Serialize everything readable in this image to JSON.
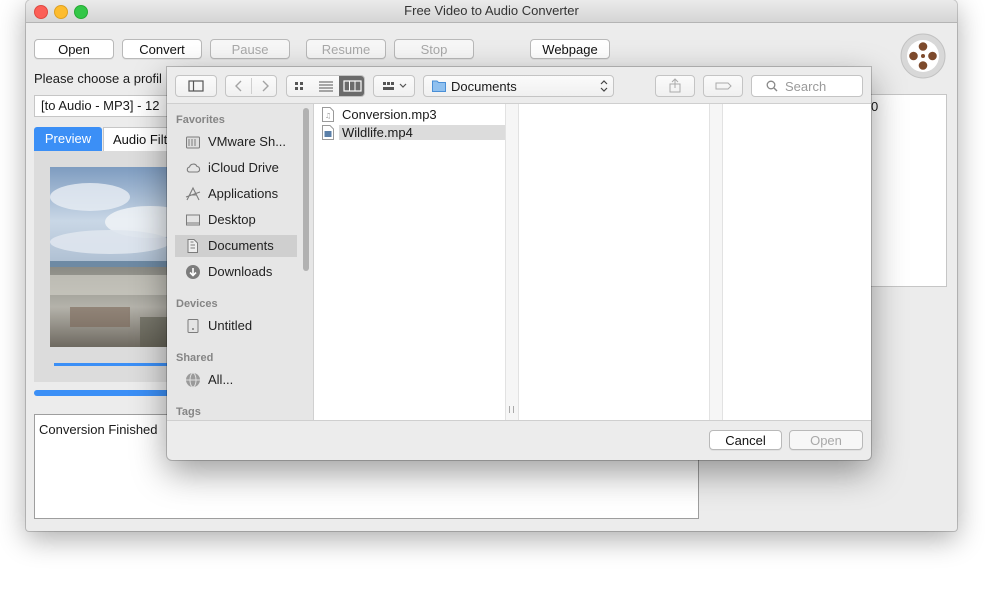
{
  "window": {
    "title": "Free Video to Audio Converter",
    "buttons": {
      "open": "Open",
      "convert": "Convert",
      "pause": "Pause",
      "resume": "Resume",
      "stop": "Stop",
      "webpage": "Webpage"
    },
    "profile_label": "Please choose a profil",
    "profile_value": "[to Audio - MP3] - 12",
    "tabs": {
      "preview": "Preview",
      "audio_filter": "Audio Filt"
    },
    "right_panel_char": "0",
    "log_text": "Conversion Finished",
    "progress_fraction": 0.45
  },
  "dialog": {
    "location": "Documents",
    "search_placeholder": "Search",
    "sidebar": {
      "favorites_heading": "Favorites",
      "favorites": [
        {
          "label": "VMware Sh...",
          "icon": "drive-icon"
        },
        {
          "label": "iCloud Drive",
          "icon": "cloud-icon"
        },
        {
          "label": "Applications",
          "icon": "applications-icon"
        },
        {
          "label": "Desktop",
          "icon": "desktop-icon"
        },
        {
          "label": "Documents",
          "icon": "documents-icon"
        },
        {
          "label": "Downloads",
          "icon": "downloads-icon"
        }
      ],
      "devices_heading": "Devices",
      "devices": [
        {
          "label": "Untitled",
          "icon": "disk-icon"
        }
      ],
      "shared_heading": "Shared",
      "shared": [
        {
          "label": "All...",
          "icon": "network-icon"
        }
      ],
      "tags_heading": "Tags"
    },
    "files": [
      {
        "name": "Conversion.mp3",
        "icon": "audio-file-icon",
        "selected": false
      },
      {
        "name": "Wildlife.mp4",
        "icon": "video-file-icon",
        "selected": true
      }
    ],
    "cancel_label": "Cancel",
    "open_label": "Open"
  }
}
